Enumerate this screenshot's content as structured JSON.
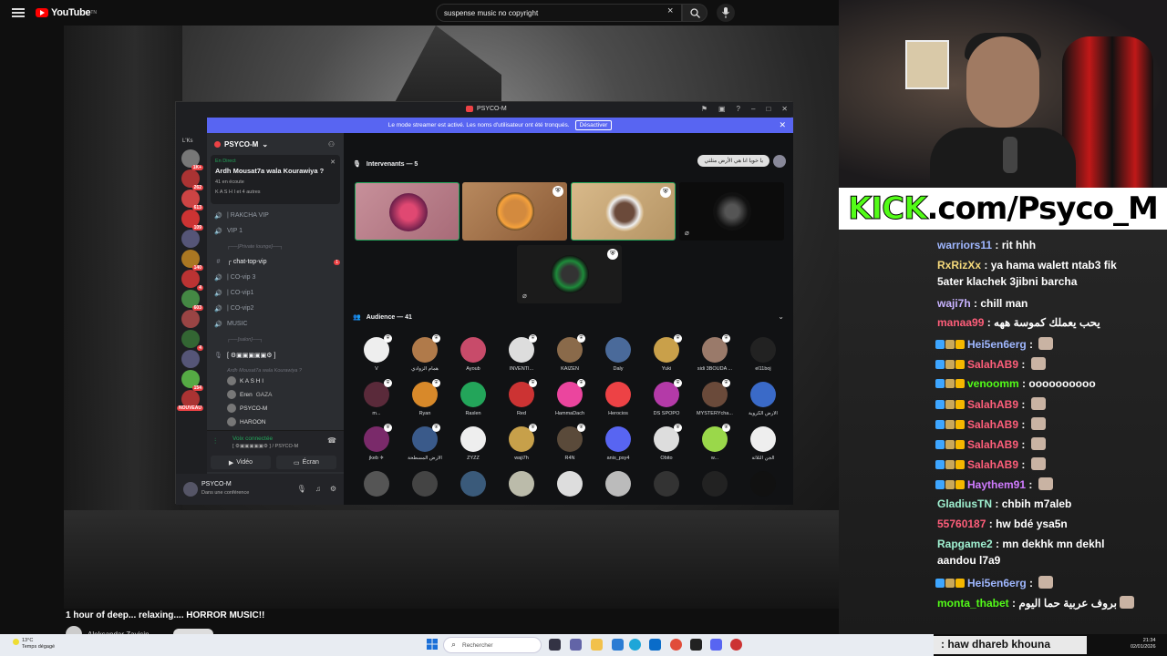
{
  "youtube": {
    "logo_text": "YouTube",
    "logo_sup": "TN",
    "search_value": "suspense music no copyright",
    "clear_icon": "×",
    "video_title": "1 hour of deep... relaxing.... HORROR MUSIC!!",
    "channel_name": "Aleksandar Zavisin"
  },
  "discord": {
    "window_title": "PSYCO-M",
    "banner_text": "Le mode streamer est activé. Les noms d'utilisateur ont été tronqués.",
    "banner_button": "Désactiver",
    "server_label": "L'Ks",
    "server_name": "PSYCO-M",
    "live": {
      "tag": "En Direct",
      "title": "Ardh Mousat7a wala Kourawiya ?",
      "listeners": "41 en écoute",
      "speakers": "K A S H I et 4 autres"
    },
    "channels": [
      {
        "icon": "🔊",
        "label": "| RAKCHA VIP"
      },
      {
        "icon": "🔊",
        "label": "VIP 1"
      },
      {
        "icon": "",
        "label": "┌──[Private lounge]──┐",
        "category": true
      },
      {
        "icon": "#",
        "label": "┌ chat-top-vip",
        "badge": "1",
        "highlight": true
      },
      {
        "icon": "🔊",
        "label": "| CO-vip 3"
      },
      {
        "icon": "🔊",
        "label": "| CO-vip1"
      },
      {
        "icon": "🔊",
        "label": "| CO-vip2"
      },
      {
        "icon": "🔊",
        "label": "MUSIC"
      },
      {
        "icon": "",
        "label": "┌──[salon]──┐",
        "category": true
      },
      {
        "icon": "🎙",
        "label": "[ ⚙▣▣▣▣▣⚙ ]",
        "highlight": true
      },
      {
        "icon": "",
        "label": "Ardh Mousat7a wala Kourawiya ?",
        "category": true
      }
    ],
    "voice_users": [
      {
        "name": "K A S H I",
        "extra": ""
      },
      {
        "name": "Eren",
        "extra": "GAZA"
      },
      {
        "name": "PSYCO-M",
        "extra": ""
      },
      {
        "name": "HAROON",
        "extra": ""
      }
    ],
    "voice_connected": "Voix connectée",
    "voice_channel": "[ ⚙▣▣▣▣▣⚙ ] / PSYCO-M",
    "video_btn": "Vidéo",
    "screen_btn": "Écran",
    "user_name": "PSYCO-M",
    "user_status": "Dans une conférence",
    "speakers_header": "Intervenants — 5",
    "stage_topic": "يا خويا انا هي الأرض مثلثي",
    "audience_header": "Audience — 41",
    "audience": [
      "V",
      "همام الزوادي",
      "Ayoub",
      "INVENTI...",
      "KAIZEN",
      "Daly",
      "Yuki",
      "sidi 3BOUDA ...",
      "el11boj",
      "m...",
      "Ryan",
      "Raslen",
      "Red",
      "HammaDach",
      "Herocios",
      "DS SPOPO",
      "MYSTERYcha...",
      "الأرض الكروية",
      "jkeb ✈",
      "الأرض المسطحة",
      "ZYZZ",
      "waji7h",
      "R4N",
      "anis_psy4",
      "Obito",
      "w...",
      "الجن الثلاثة",
      "",
      "",
      "",
      "",
      "",
      "",
      "",
      "",
      ""
    ],
    "server_badges": [
      "1K+",
      "262",
      "613",
      "109",
      "",
      "140",
      "4",
      "603",
      "",
      "4",
      "",
      "154",
      "NOUVEAU"
    ]
  },
  "kick_banner": {
    "prefix": "KICK",
    "suffix": ".com/Psyco_M"
  },
  "chat": [
    {
      "user": "warriors11",
      "text": "rit hhh",
      "color": "#9fb7ff"
    },
    {
      "user": "RxRizXx",
      "text": "ya hama walett ntab3 fik",
      "color": "#f5d97b"
    },
    {
      "user": "",
      "text": "5ater klachek 3jibni barcha",
      "color": "#fff"
    },
    {
      "user": "waji7h",
      "text": "chill man",
      "color": "#c8b3ff"
    },
    {
      "user": "manaa99",
      "text": "يحب يعملك كموسة ههه",
      "color": "#ff5e7a"
    },
    {
      "user": "Hei5en6erg",
      "text": "",
      "color": "#9fb7ff"
    },
    {
      "user": "SalahAB9",
      "text": "",
      "color": "#ff5e7a"
    },
    {
      "user": "venoomm",
      "text": "oooooooooo",
      "color": "#53fc18"
    },
    {
      "user": "SalahAB9",
      "text": "",
      "color": "#ff5e7a"
    },
    {
      "user": "SalahAB9",
      "text": "",
      "color": "#ff5e7a"
    },
    {
      "user": "SalahAB9",
      "text": "",
      "color": "#ff5e7a"
    },
    {
      "user": "SalahAB9",
      "text": "",
      "color": "#ff5e7a"
    },
    {
      "user": "Haythem91",
      "text": "",
      "color": "#d07bff"
    },
    {
      "user": "GladiusTN",
      "text": "chbih m7aleb",
      "color": "#9ff0d0"
    },
    {
      "user": "55760187",
      "text": "hw bdé ysa5n",
      "color": "#ff5e7a"
    },
    {
      "user": "Rapgame2",
      "text": "mn dekhk mn dekhl",
      "color": "#9ff0d0"
    },
    {
      "user": "",
      "text": "aandou l7a9",
      "color": "#fff"
    },
    {
      "user": "Hei5en6erg",
      "text": "",
      "color": "#9fb7ff"
    },
    {
      "user": "monta_thabet",
      "text": "بروف عربية حما اليوم",
      "color": "#53fc18"
    }
  ],
  "chat_input": ": haw dhareb khouna",
  "taskbar": {
    "temp": "13°C",
    "weather": "Temps dégagé",
    "search": "Rechercher",
    "time": "21:34",
    "date": "02/01/2026"
  }
}
